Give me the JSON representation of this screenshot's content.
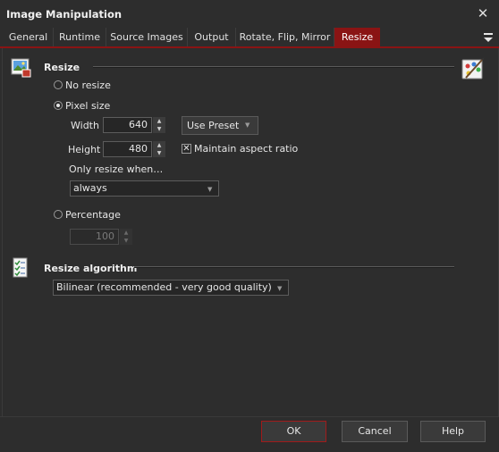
{
  "window": {
    "title": "Image Manipulation"
  },
  "tabs": [
    {
      "label": "General"
    },
    {
      "label": "Runtime"
    },
    {
      "label": "Source Images"
    },
    {
      "label": "Output"
    },
    {
      "label": "Rotate, Flip, Mirror"
    },
    {
      "label": "Resize",
      "active": true
    }
  ],
  "resize": {
    "heading": "Resize",
    "no_resize_label": "No resize",
    "pixel_size_label": "Pixel size",
    "selected_mode": "Pixel size",
    "width_label": "Width",
    "width_value": "640",
    "height_label": "Height",
    "height_value": "480",
    "use_preset_label": "Use Preset",
    "maintain_aspect_label": "Maintain aspect ratio",
    "maintain_aspect_checked": true,
    "only_resize_label": "Only resize when…",
    "only_resize_value": "always",
    "percentage_label": "Percentage",
    "percentage_value": "100"
  },
  "algorithm": {
    "heading": "Resize algorithm",
    "value": "Bilinear (recommended - very good quality)"
  },
  "footer": {
    "ok_label": "OK",
    "cancel_label": "Cancel",
    "help_label": "Help"
  },
  "icons": {
    "resize_section": "image-resize-icon",
    "resize_right": "palette-edit-icon",
    "algorithm_section": "checklist-icon"
  },
  "colors": {
    "accent": "#8a1414",
    "background": "#2d2d2d"
  }
}
